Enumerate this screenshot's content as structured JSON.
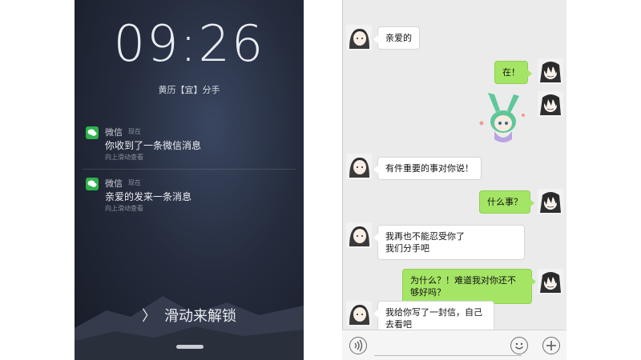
{
  "lock_screen": {
    "time": "09:26",
    "calendar_line": "黄历【宜】分手",
    "notifications": [
      {
        "app": "微信",
        "time": "现在",
        "message": "你收到了一条微信消息",
        "hint": "向上滑动查看"
      },
      {
        "app": "微信",
        "time": "现在",
        "message": "亲爱的发来一条消息",
        "hint": "向上滑动查看"
      }
    ],
    "unlock_text": "滑动来解锁",
    "unlock_chevron": "〉"
  },
  "chat": {
    "messages": [
      {
        "from": "other",
        "text": "亲爱的"
      },
      {
        "from": "me",
        "text": "在！"
      },
      {
        "from": "me",
        "type": "sticker"
      },
      {
        "from": "other",
        "text": "有件重要的事对你说！"
      },
      {
        "from": "me",
        "text": "什么事？"
      },
      {
        "from": "other",
        "text_lines": [
          "我再也不能忍受你了",
          "我们分手吧"
        ]
      },
      {
        "from": "me",
        "text_lines": [
          "为什么？！难道我对你还不",
          "够好吗？"
        ]
      },
      {
        "from": "other",
        "text_lines": [
          "我给你写了一封信，自己",
          "去看吧"
        ]
      }
    ],
    "input_bar": {
      "voice_icon": "voice-icon",
      "emoji_icon": "emoji-icon",
      "plus_icon": "plus-icon"
    }
  },
  "colors": {
    "my_bubble": "#a5e565",
    "other_bubble": "#ffffff",
    "wechat_green": "#2db34a"
  }
}
